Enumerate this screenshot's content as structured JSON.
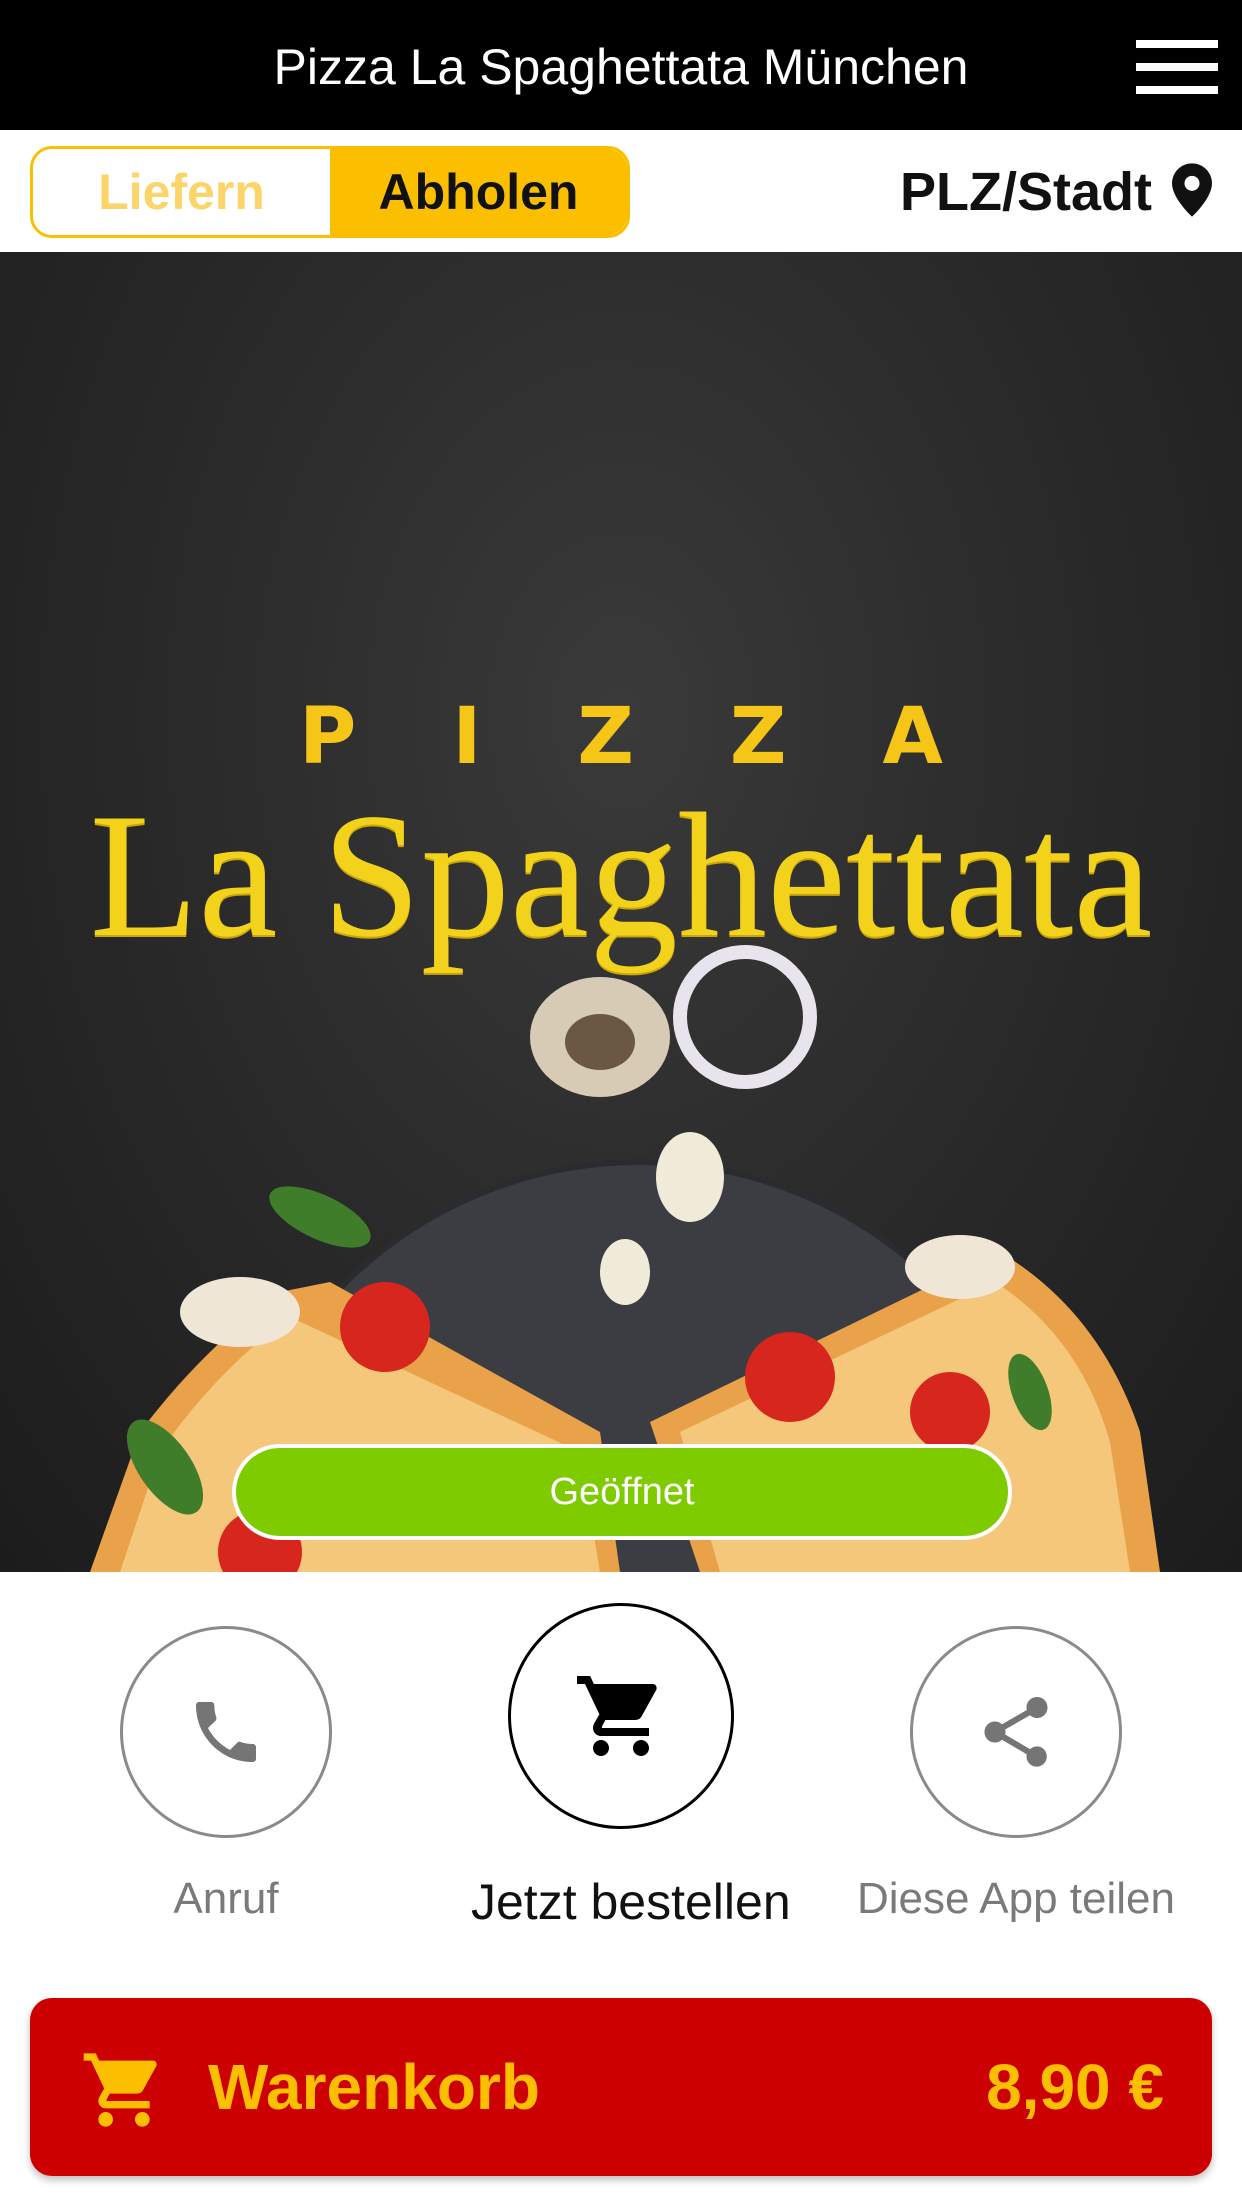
{
  "header": {
    "title": "Pizza La Spaghettata München"
  },
  "mode_toggle": {
    "options": [
      "Liefern",
      "Abholen"
    ],
    "selected": "Abholen"
  },
  "location": {
    "label": "PLZ/Stadt",
    "icon": "map-pin-icon"
  },
  "hero": {
    "logo_line1": "PIZZA",
    "logo_line2": "La Spaghettata",
    "status": "Geöffnet"
  },
  "actions": [
    {
      "label": "Anruf",
      "icon": "phone-icon"
    },
    {
      "label": "Jetzt bestellen",
      "icon": "cart-icon"
    },
    {
      "label": "Diese App teilen",
      "icon": "share-icon"
    }
  ],
  "cart": {
    "label": "Warenkorb",
    "total": "8,90 €",
    "icon": "cart-icon"
  },
  "colors": {
    "header_bg": "#000000",
    "accent_yellow": "#fbbf00",
    "open_green": "#7ecb00",
    "cart_red": "#cc0000"
  }
}
